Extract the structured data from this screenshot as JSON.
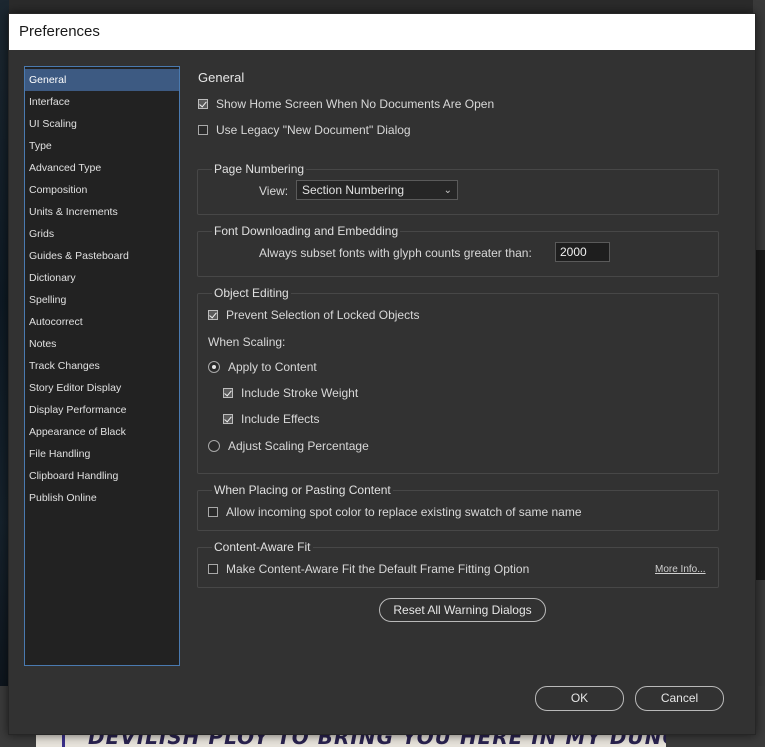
{
  "window": {
    "title": "Preferences"
  },
  "background": {
    "comic_text": "DEVILISH PLOY TO BRING YOU HERE IN MY DUNGEON!"
  },
  "sidebar": {
    "items": [
      {
        "label": "General"
      },
      {
        "label": "Interface"
      },
      {
        "label": "UI Scaling"
      },
      {
        "label": "Type"
      },
      {
        "label": "Advanced Type"
      },
      {
        "label": "Composition"
      },
      {
        "label": "Units & Increments"
      },
      {
        "label": "Grids"
      },
      {
        "label": "Guides & Pasteboard"
      },
      {
        "label": "Dictionary"
      },
      {
        "label": "Spelling"
      },
      {
        "label": "Autocorrect"
      },
      {
        "label": "Notes"
      },
      {
        "label": "Track Changes"
      },
      {
        "label": "Story Editor Display"
      },
      {
        "label": "Display Performance"
      },
      {
        "label": "Appearance of Black"
      },
      {
        "label": "File Handling"
      },
      {
        "label": "Clipboard Handling"
      },
      {
        "label": "Publish Online"
      }
    ],
    "selected": "General"
  },
  "general": {
    "heading": "General",
    "show_home_screen": {
      "label": "Show Home Screen When No Documents Are Open",
      "checked": true
    },
    "use_legacy_new_doc": {
      "label": "Use Legacy \"New Document\" Dialog",
      "checked": false
    }
  },
  "page_numbering": {
    "legend": "Page Numbering",
    "view_label": "View:",
    "view_value": "Section Numbering"
  },
  "font_downloading": {
    "legend": "Font Downloading and Embedding",
    "subset_label": "Always subset fonts with glyph counts greater than:",
    "subset_value": "2000"
  },
  "object_editing": {
    "legend": "Object Editing",
    "prevent_selection": {
      "label": "Prevent Selection of Locked Objects",
      "checked": true
    },
    "when_scaling_label": "When Scaling:",
    "apply_to_content": {
      "label": "Apply to Content",
      "selected": true
    },
    "include_stroke_weight": {
      "label": "Include Stroke Weight",
      "checked": true
    },
    "include_effects": {
      "label": "Include Effects",
      "checked": true
    },
    "adjust_scaling": {
      "label": "Adjust Scaling Percentage",
      "selected": false
    }
  },
  "placing": {
    "legend": "When Placing or Pasting Content",
    "spot_color": {
      "label": "Allow incoming spot color to replace existing swatch of same name",
      "checked": false
    }
  },
  "content_aware": {
    "legend": "Content-Aware Fit",
    "default_option": {
      "label": "Make Content-Aware Fit the Default Frame Fitting Option",
      "checked": false
    },
    "more_info": "More Info..."
  },
  "buttons": {
    "reset_warnings": "Reset All Warning Dialogs",
    "ok": "OK",
    "cancel": "Cancel"
  },
  "colors": {
    "dialog_bg": "#323232",
    "sidebar_bg": "#222222",
    "selection": "#3d5a82",
    "sidebar_border": "#4a7ab0"
  }
}
